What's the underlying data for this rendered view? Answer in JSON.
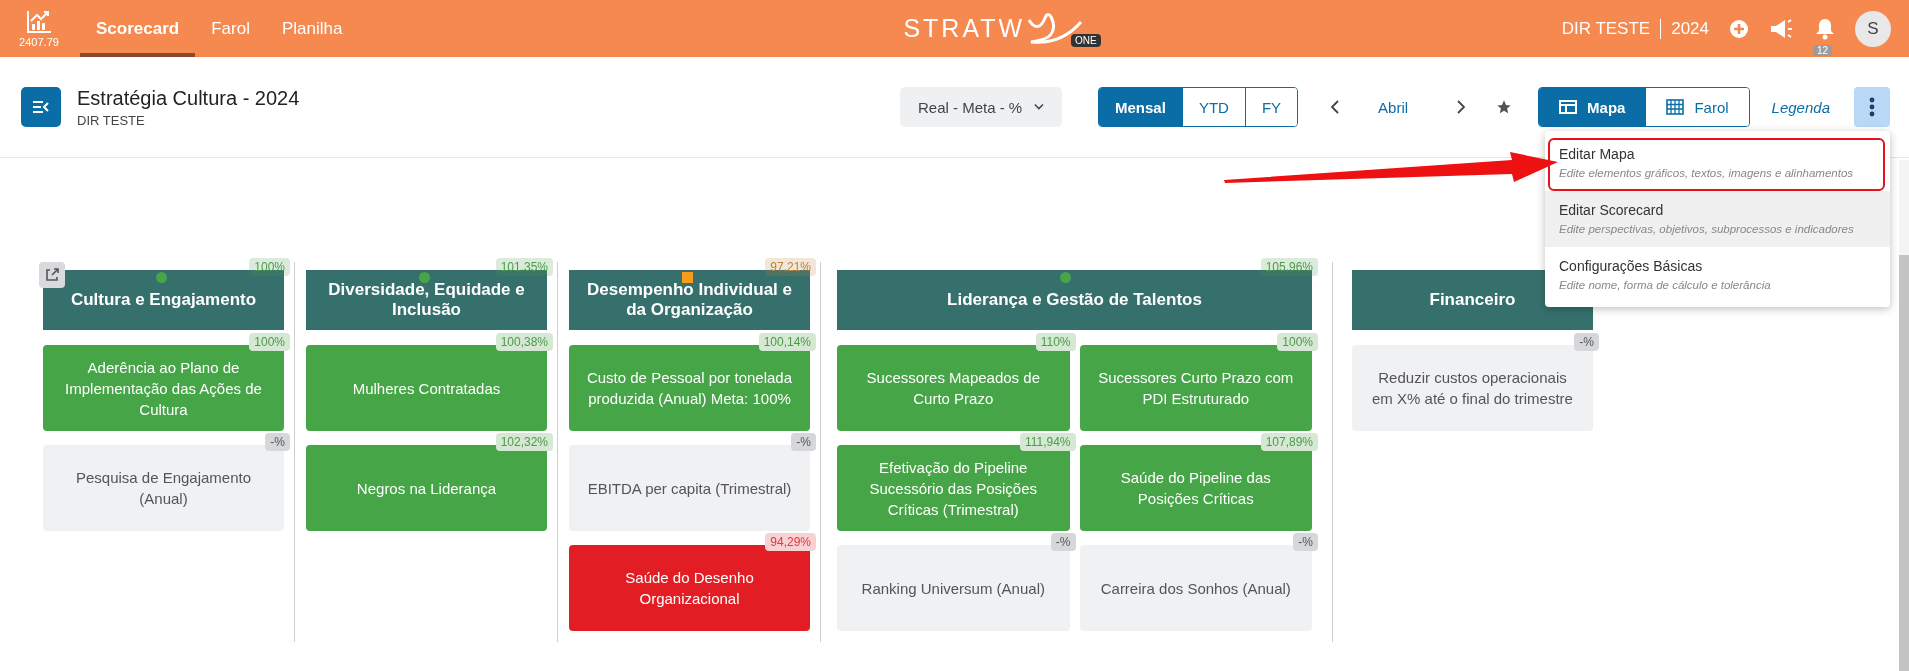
{
  "topbar": {
    "score": "2407.79",
    "tabs": [
      {
        "label": "Scorecard",
        "selected": true
      },
      {
        "label": "Farol",
        "selected": false
      },
      {
        "label": "Planilha",
        "selected": false
      }
    ],
    "logo": {
      "word": "STRATW",
      "badge": "ONE"
    },
    "unit": "DIR TESTE",
    "year": "2024",
    "notifications": "12",
    "avatar": "S"
  },
  "header": {
    "title": "Estratégia Cultura - 2024",
    "subtitle": "DIR TESTE",
    "view_select": "Real - Meta - %",
    "periods": [
      {
        "label": "Mensal",
        "selected": true
      },
      {
        "label": "YTD",
        "selected": false
      },
      {
        "label": "FY",
        "selected": false
      }
    ],
    "month": "Abril",
    "views": [
      {
        "label": "Mapa",
        "kind": "map",
        "selected": true
      },
      {
        "label": "Farol",
        "kind": "grid",
        "selected": false
      }
    ],
    "legend": "Legenda"
  },
  "columns": [
    {
      "title": "Cultura e Engajamento",
      "badge": {
        "text": "100%",
        "color": "#4c9a4a"
      },
      "marker": {
        "kind": "dot",
        "color": "#46a546"
      },
      "kind": "single",
      "cards": [
        {
          "text": "Aderência ao Plano de Implementação das Ações de Cultura",
          "badge": "100%",
          "kind": "met"
        },
        {
          "text": "Pesquisa de Engajamento (Anual)",
          "badge": "-%",
          "kind": "empty"
        }
      ]
    },
    {
      "title": "Diversidade, Equidade e Inclusão",
      "badge": {
        "text": "101,35%",
        "color": "#4c9a4a"
      },
      "marker": {
        "kind": "dot",
        "color": "#46a546"
      },
      "kind": "single",
      "cards": [
        {
          "text": "Mulheres Contratadas",
          "badge": "100,38%",
          "kind": "met"
        },
        {
          "text": "Negros na Liderança",
          "badge": "102,32%",
          "kind": "met"
        }
      ]
    },
    {
      "title": "Desempenho Individual e da Organização",
      "badge": {
        "text": "97,21%",
        "color": "#b98436"
      },
      "marker": {
        "kind": "square",
        "color": "#f59c1a"
      },
      "kind": "single",
      "cards": [
        {
          "text": "Custo de Pessoal por tonelada produzida (Anual) Meta: 100%",
          "badge": "100,14%",
          "kind": "met"
        },
        {
          "text": "EBITDA per capita (Trimestral)",
          "badge": "-%",
          "kind": "empty"
        },
        {
          "text": "Saúde do Desenho Organizacional",
          "badge": "94,29%",
          "kind": "missed"
        }
      ]
    },
    {
      "title": "Liderança e Gestão de Talentos",
      "badge": {
        "text": "105,96%",
        "color": "#4c9a4a"
      },
      "marker": {
        "kind": "dot",
        "color": "#46a546"
      },
      "kind": "double",
      "cards": [
        {
          "text": "Sucessores Mapeados de Curto Prazo",
          "badge": "110%",
          "kind": "met"
        },
        {
          "text": "Sucessores Curto Prazo com PDI Estruturado",
          "badge": "100%",
          "kind": "met"
        },
        {
          "text": "Efetivação do Pipeline Sucessório das Posições Críticas (Trimestral)",
          "badge": "111,94%",
          "kind": "met"
        },
        {
          "text": "Saúde do Pipeline das Posições Críticas",
          "badge": "107,89%",
          "kind": "met"
        },
        {
          "text": "Ranking Universum (Anual)",
          "badge": "-%",
          "kind": "empty"
        },
        {
          "text": "Carreira dos Sonhos (Anual)",
          "badge": "-%",
          "kind": "empty"
        }
      ]
    },
    {
      "title": "Financeiro",
      "kind": "single",
      "cards": [
        {
          "text": "Reduzir custos operacionais em X% até o final do trimestre",
          "badge": "-%",
          "kind": "empty"
        }
      ]
    }
  ],
  "menu": [
    {
      "title": "Editar Mapa",
      "hint": "Edite elementos gráficos, textos, imagens e alinhamentos",
      "highlighted": false
    },
    {
      "title": "Editar Scorecard",
      "hint": "Edite perspectivas, objetivos, subprocessos e indicadores",
      "highlighted": true
    },
    {
      "title": "Configurações Básicas",
      "hint": "Edite nome, forma de cálculo e tolerância",
      "highlighted": false
    }
  ]
}
